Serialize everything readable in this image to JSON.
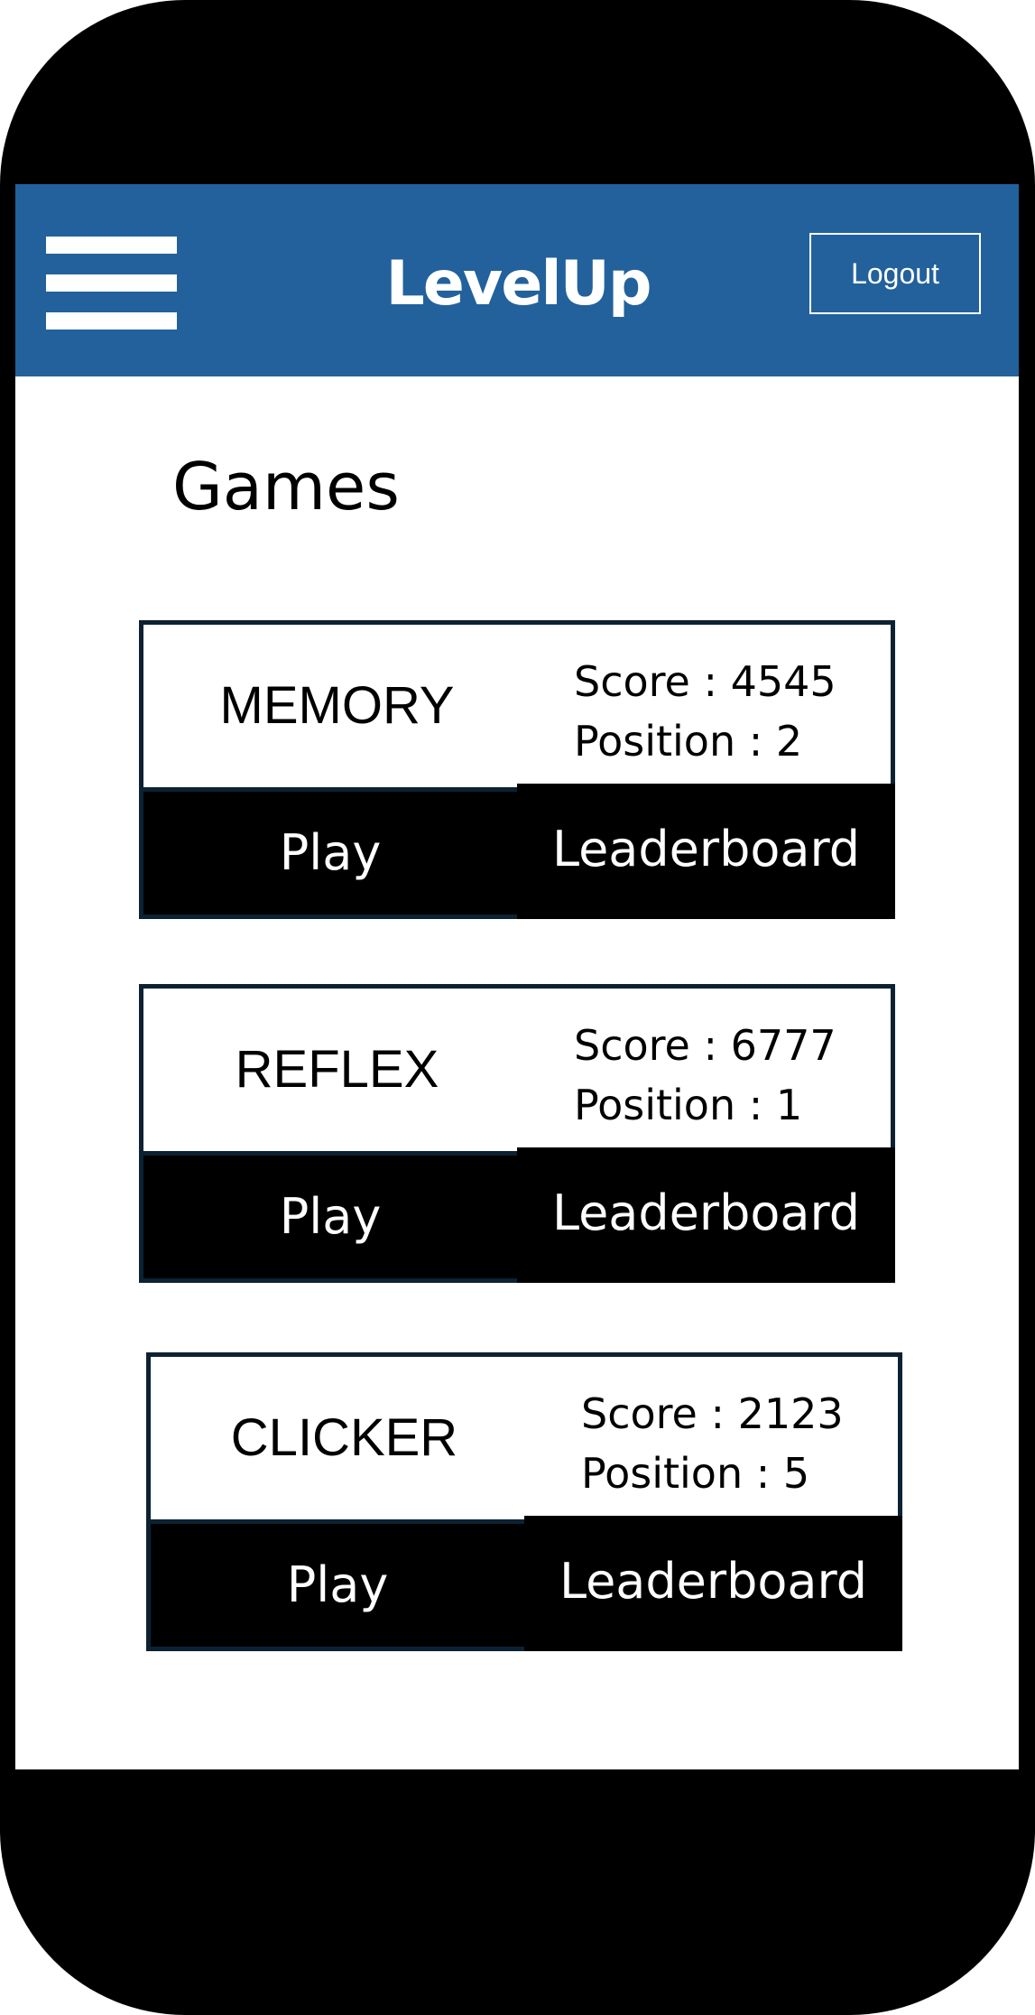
{
  "app": {
    "name": "LevelUp"
  },
  "header": {
    "menu_icon": "hamburger-menu-icon",
    "logout_label": "Logout"
  },
  "page": {
    "title": "Games"
  },
  "games": [
    {
      "name": "MEMORY",
      "score": "Score : 4545",
      "position": "Position : 2",
      "play_label": "Play",
      "leaderboard_label": "Leaderboard"
    },
    {
      "name": "REFLEX",
      "score": "Score : 6777",
      "position": "Position : 1",
      "play_label": "Play",
      "leaderboard_label": "Leaderboard"
    },
    {
      "name": "CLICKER",
      "score": "Score : 2123",
      "position": "Position : 5",
      "play_label": "Play",
      "leaderboard_label": "Leaderboard"
    }
  ],
  "colors": {
    "header_bg": "#22619c",
    "device_frame": "#000000",
    "card_border": "#0c2233",
    "button_bg": "#000000"
  }
}
